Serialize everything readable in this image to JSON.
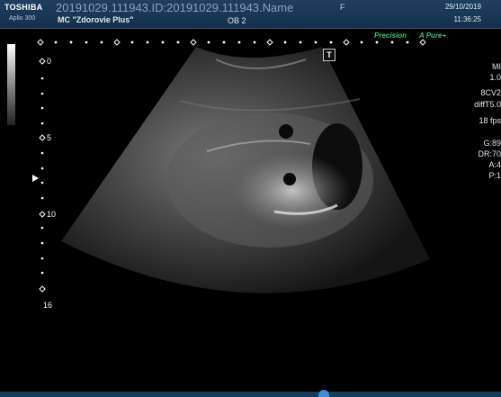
{
  "header": {
    "brand": "TOSHIBA",
    "model": "Aplio 300",
    "patient": "20191029.111943.ID:20191029.111943.Name",
    "sex": "F",
    "clinic": "MC \"Zdorovie Plus\"",
    "exam": "OB 2",
    "date": "29/10/2019",
    "time": "11:36:25"
  },
  "modes": {
    "precision": "Precision",
    "apure": "A Pure+"
  },
  "marker": "T",
  "depth_scale": [
    "0",
    "5",
    "10",
    "16"
  ],
  "parameters": [
    "MI",
    "1.0",
    "8CV2",
    "diffT5.0",
    "18 fps",
    "G:89",
    "DR:70",
    "A:4",
    "P:1"
  ]
}
